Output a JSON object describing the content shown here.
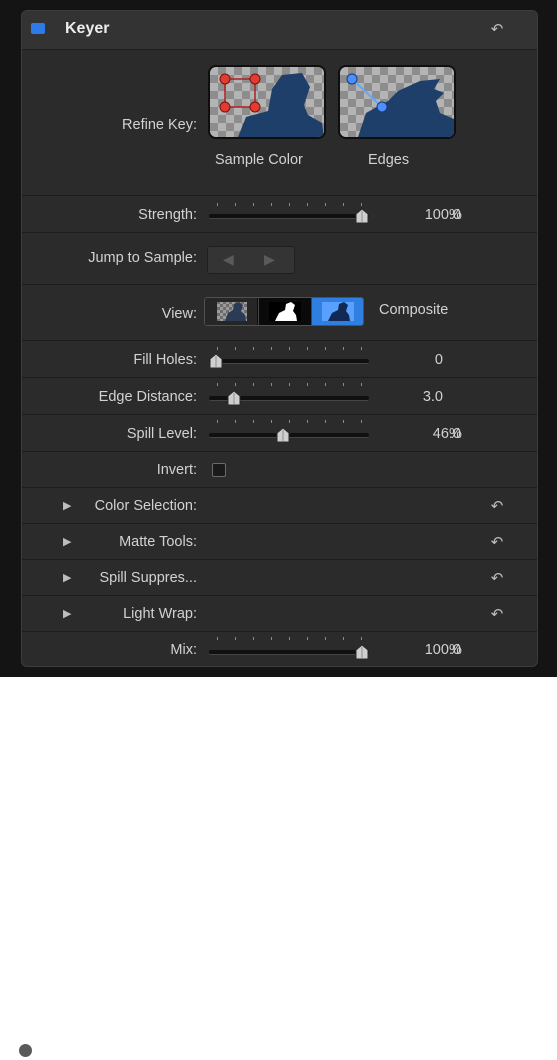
{
  "panel": {
    "title": "Keyer",
    "enabled": true,
    "accent_color": "#2b7ce9"
  },
  "refine_key": {
    "label": "Refine Key:",
    "buttons": [
      {
        "label": "Sample Color",
        "icon": "sample-color-icon"
      },
      {
        "label": "Edges",
        "icon": "edges-icon"
      }
    ]
  },
  "strength": {
    "label": "Strength:",
    "value": "100.0",
    "unit": "%",
    "level": 1.0
  },
  "jump_to_sample": {
    "label": "Jump to Sample:",
    "prev_icon": "arrow-left-icon",
    "next_icon": "arrow-right-icon"
  },
  "view": {
    "label": "View:",
    "options": [
      "matte-icon",
      "composite-bw-icon",
      "composite-icon"
    ],
    "selected": "Composite",
    "selected_index": 2
  },
  "fill_holes": {
    "label": "Fill Holes:",
    "value": "0",
    "level": 0.0
  },
  "edge_distance": {
    "label": "Edge Distance:",
    "value": "3.0",
    "level": 0.12
  },
  "spill_level": {
    "label": "Spill Level:",
    "value": "46.0",
    "unit": "%",
    "level": 0.46
  },
  "invert": {
    "label": "Invert:",
    "checked": false
  },
  "groups": [
    {
      "label": "Color Selection:"
    },
    {
      "label": "Matte Tools:"
    },
    {
      "label": "Spill Suppres..."
    },
    {
      "label": "Light Wrap:"
    }
  ],
  "mix": {
    "label": "Mix:",
    "value": "100.0",
    "unit": "%",
    "level": 1.0
  }
}
